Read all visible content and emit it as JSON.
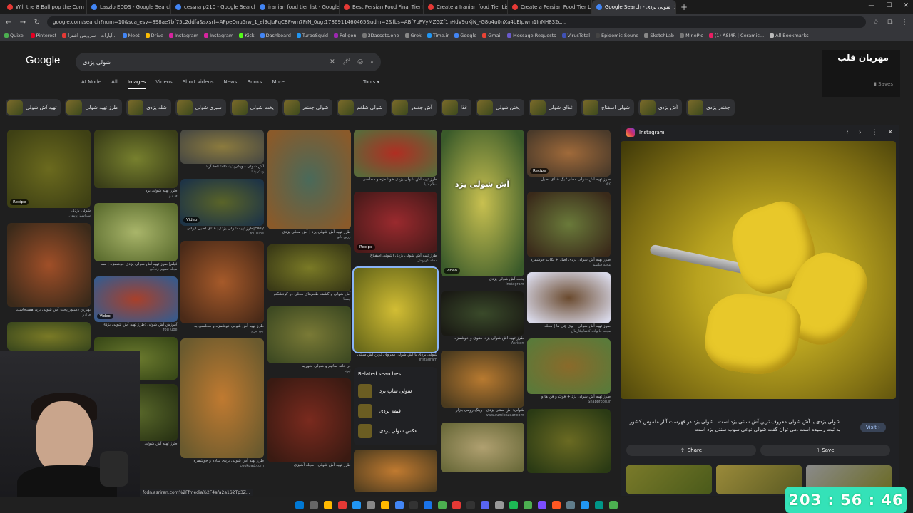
{
  "browser": {
    "tabs": [
      {
        "label": "Will the 8 Ball pop the Corn",
        "color": "#e53935"
      },
      {
        "label": "Laszlo EDDS - Google Search",
        "color": "#4285f4"
      },
      {
        "label": "cessna p210 - Google Search",
        "color": "#4285f4"
      },
      {
        "label": "iranian food tier list - Google S",
        "color": "#4285f4"
      },
      {
        "label": "Best Persian Food Final Tier List",
        "color": "#e53935"
      },
      {
        "label": "Create a Iranian food Tier List",
        "color": "#e53935"
      },
      {
        "label": "Create a Persian Food Tier List",
        "color": "#e53935"
      },
      {
        "label": "Google Search - شولی یزدی",
        "color": "#4285f4",
        "active": true
      }
    ],
    "url": "google.com/search?num=10&sca_esv=898ae7bf75c2ddfa&sxsrf=APpeQnu5rw_1_el9cJuPqCBFwm7FrN_0ug:1786911460465&udm=2&fbs=ABf7bFVyMZGZf1hHdV9uKjN_-G8o4u0nXa4bEIpwm1InNH832c...",
    "bookmarks": [
      "Quixel",
      "Pinterest",
      "آپارات - سرویس اشترا...",
      "Meet",
      "Drive",
      "Instagram",
      "Instagram",
      "Kick",
      "Dashboard",
      "TurboSquid",
      "Poligon",
      "3Dassets.one",
      "Grok",
      "Time.ir",
      "Google",
      "Gmail",
      "Message Requests",
      "VirusTotal",
      "Epidemic Sound",
      "SketchLab",
      "MinePic",
      "(1) ASMR | Ceramic...",
      "All Bookmarks"
    ]
  },
  "google": {
    "logo": "Google",
    "query": "شولی یزدی",
    "tabs": [
      "AI Mode",
      "All",
      "Images",
      "Videos",
      "Short videos",
      "News",
      "Books",
      "More"
    ],
    "active_tab": "Images",
    "tools": "Tools",
    "profile_name": "مهربان قلب",
    "saved": "Saves",
    "chips": [
      "تهیه آش شولی",
      "طرز تهیه شولی",
      "شله یزدی",
      "سبزی شولی",
      "پخت شولی",
      "شولی چغندر",
      "شولی شلغم",
      "آش چغندر",
      "غذا",
      "پختن شولی",
      "غذای شولی",
      "شولی اسفناج",
      "آش یزدی",
      "چغندر یزدی"
    ]
  },
  "results": {
    "col1": [
      {
        "cap": "شولی یزدی",
        "src": "سرآشپز پاپیون",
        "badge": "Recipe",
        "h": 110,
        "c1": "#6b6a1e",
        "c2": "#3e4014"
      },
      {
        "cap": "بهترین دستور پخت آش شولی یزد، همینجاست",
        "src": "فرارو",
        "badge": "",
        "h": 118,
        "c1": "#a04f28",
        "c2": "#3b2a1a"
      },
      {
        "cap": "",
        "src": "",
        "badge": "",
        "h": 40,
        "c1": "#7a7a26",
        "c2": "#3d4a1d"
      }
    ],
    "col2": [
      {
        "cap": "طرز تهیه شولی یزد",
        "src": "فرارو",
        "badge": "",
        "h": 82,
        "c1": "#77802e",
        "c2": "#3a3e18"
      },
      {
        "cap": "فیلم| طرز تهیه آش شولی یزدی خوشمزه | سه",
        "src": "مجله تصویر زندگی",
        "badge": "",
        "h": 82,
        "c1": "#a9b56a",
        "c2": "#5d6e30"
      },
      {
        "cap": "آموزش آش شولی :طرز تهیه آش شولی یزدی",
        "src": "YouTube",
        "badge": "Video",
        "h": 64,
        "c1": "#a9402a",
        "c2": "#3a5a8a"
      },
      {
        "cap": "",
        "src": "",
        "badge": "",
        "h": 60,
        "c1": "#6b7a2e",
        "c2": "#3a4a18"
      },
      {
        "cap": "طرز تهیه آش شولی",
        "src": "",
        "badge": "",
        "h": 80,
        "c1": "#59682a",
        "c2": "#2a3414"
      }
    ],
    "col3": [
      {
        "cap": "آش شولی - ویکی‌پدیا، دانشنامهٔ آزاد",
        "src": "ویکی‌پدیا",
        "badge": "",
        "h": 48,
        "c1": "#8c7b3e",
        "c2": "#4a4a42"
      },
      {
        "cap": "Easy|طرز تهیه شولی یزدی| غذای اصیل ایرانی",
        "src": "YouTube",
        "badge": "Video",
        "h": 66,
        "c1": "#5a6428",
        "c2": "#1e3446"
      },
      {
        "cap": "طرز تهیه آش شولی خوشمزه و مجلسی به",
        "src": "چی بپزم",
        "badge": "",
        "h": 116,
        "c1": "#a65a2a",
        "c2": "#4a2a18"
      },
      {
        "cap": "طرز تهیه آش شولی یزدی ساده و خوشمزه",
        "src": "cookpad.com",
        "badge": "",
        "h": 168,
        "c1": "#c07a30",
        "c2": "#6a5a2e"
      }
    ],
    "col4": [
      {
        "cap": "طرز تهیه آش شولی یزد | آش محلی یزدی",
        "src": "زرین بانو",
        "badge": "",
        "h": 140,
        "c1": "#4a6a5a",
        "c2": "#8a5a2a"
      },
      {
        "cap": "آش شولی و کشف طعم‌های محلی در کردشکنو",
        "src": "ایسنا",
        "badge": "",
        "h": 66,
        "c1": "#7a7a26",
        "c2": "#3a3a16"
      },
      {
        "cap": "در خانه بمانیم و شولی بخوریم",
        "src": "ایرنا",
        "badge": "",
        "h": 80,
        "c1": "#7a7a36",
        "c2": "#3e4a22"
      },
      {
        "cap": "طرز تهیه آش شولی - مجله آشپزی",
        "src": "",
        "badge": "",
        "h": 118,
        "c1": "#7a2a1e",
        "c2": "#3a1a12"
      }
    ],
    "col5": [
      {
        "cap": "طرز تهیه آش شولی یزدی خوشمزه و مجلسی",
        "src": "سلام دنیا",
        "badge": "",
        "h": 66,
        "c1": "#b02e22",
        "c2": "#5a6a3a"
      },
      {
        "cap": "طرز تهیه آش شولی یزدی (شولی اسفناج)",
        "src": "مجله کوروش",
        "badge": "Recipe",
        "h": 86,
        "c1": "#9a2a2e",
        "c2": "#4a1a1a"
      },
      {
        "cap": "شولی یزدی یا آش شولی معروف ترین آش سنتی",
        "src": "Instagram",
        "badge": "",
        "h": 118,
        "c1": "#d2bd34",
        "c2": "#6a6a1a",
        "selected": true
      }
    ],
    "col6": [
      {
        "cap": "پخت آش شولی یزدی",
        "src": "Instagram",
        "badge": "Video",
        "h": 206,
        "c1": "#c8c050",
        "c2": "#3a5a2a",
        "overlay": "آش شولی یزد"
      },
      {
        "cap": "طرز تهیه آش شولی یزد، مقوی و خوشمزه",
        "src": "Asriran",
        "badge": "",
        "h": 62,
        "c1": "#3a4a2a",
        "c2": "#1a1a14"
      },
      {
        "cap": "شولی: آش سنتی یزدی - ویتک رومی بازار",
        "src": "www.rumibazaar.com",
        "badge": "",
        "h": 80,
        "c1": "#b87a30",
        "c2": "#4a3a1e"
      },
      {
        "cap": "",
        "src": "",
        "badge": "",
        "h": 70,
        "c1": "#b0a070",
        "c2": "#6a6a3a"
      }
    ],
    "col7": [
      {
        "cap": "طرز تهیه آش شولی محلی؛ یک غذای اصیل",
        "src": "کالا",
        "badge": "Recipe",
        "h": 66,
        "c1": "#a06a3a",
        "c2": "#4a3a2a"
      },
      {
        "cap": "طرز تهیه آش شولی یزدی اصل + نکات خوشمزه",
        "src": "مجله فیلیمو",
        "badge": "",
        "h": 92,
        "c1": "#6a7a3a",
        "c2": "#3a2a1a"
      },
      {
        "cap": "طرز تهیه آش شولی - بوی چی ها | مجله",
        "src": "مجله خانواده کاشانیکارمان",
        "badge": "",
        "h": 72,
        "c1": "#6a4a2e",
        "c2": "#d8d8e8"
      },
      {
        "cap": "طرز تهیه آش شولی یزد + فوت و فن ها و",
        "src": "Snappfood.ir",
        "badge": "",
        "h": 78,
        "c1": "#8a6a2a",
        "c2": "#5a7a3a"
      },
      {
        "cap": "",
        "src": "",
        "badge": "",
        "h": 90,
        "c1": "#6a6a22",
        "c2": "#2a3a14"
      }
    ],
    "related_title": "Related searches",
    "related": [
      "شولی شاپ یزد",
      "قیمه یزدی",
      "عکس شولی یزدی"
    ]
  },
  "panel": {
    "source": "Instagram",
    "description": "شولی یزدی یا آش شولی معروف ترین آش سنتی یزد است . شولی یزد در فهرست آثار ملموس کشور به ثبت رسیده است .می توان گفت شولی،نوعی سوپ سنتی یزد است",
    "visit": "Visit",
    "share": "Share",
    "save": "Save"
  },
  "status_url": "fcdn.asriran.com%2Ffmedia%2F4afa2a1S2Tp3Z...",
  "overlay_timer": "203 : 56 : 46"
}
